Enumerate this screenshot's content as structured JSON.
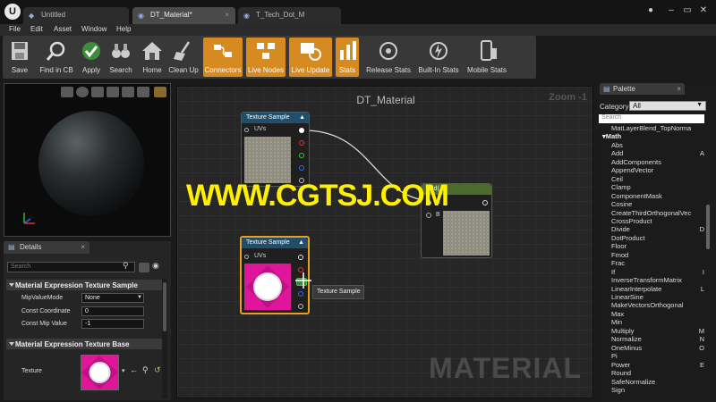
{
  "tabs": [
    {
      "label": "Untitled"
    },
    {
      "label": "DT_Material*"
    },
    {
      "label": "T_Tech_Dot_M"
    }
  ],
  "menu": [
    "File",
    "Edit",
    "Asset",
    "Window",
    "Help"
  ],
  "toolbar": [
    {
      "label": "Save",
      "icon": "save-icon"
    },
    {
      "label": "Find in CB",
      "icon": "find-icon"
    },
    {
      "label": "Apply",
      "icon": "apply-check-icon"
    },
    {
      "label": "Search",
      "icon": "binoculars-icon"
    },
    {
      "label": "Home",
      "icon": "home-icon"
    },
    {
      "label": "Clean Up",
      "icon": "broom-icon"
    },
    {
      "label": "Connectors",
      "icon": "connectors-icon",
      "active": true
    },
    {
      "label": "Live Nodes",
      "icon": "live-nodes-icon",
      "active": true
    },
    {
      "label": "Live Update",
      "icon": "live-update-icon",
      "active": true
    },
    {
      "label": "Stats",
      "icon": "stats-icon",
      "active": true
    },
    {
      "label": "Release Stats",
      "icon": "release-stats-icon"
    },
    {
      "label": "Built-In Stats",
      "icon": "builtin-stats-icon"
    },
    {
      "label": "Mobile Stats",
      "icon": "mobile-stats-icon"
    }
  ],
  "details": {
    "tab_label": "Details",
    "search_placeholder": "Search",
    "section1": "Material Expression Texture Sample",
    "props": [
      {
        "label": "MipValueMode",
        "value": "None"
      },
      {
        "label": "Const Coordinate",
        "value": "0"
      },
      {
        "label": "Const Mip Value",
        "value": "-1"
      }
    ],
    "section2": "Material Expression Texture Base",
    "texture_label": "Texture"
  },
  "graph": {
    "title": "DT_Material",
    "zoom": "Zoom -1",
    "watermark": "MATERIAL",
    "node1": {
      "title": "Texture Sample",
      "uvs": "UVs"
    },
    "node2": {
      "title": "Texture Sample",
      "uvs": "UVs"
    },
    "add_node": {
      "title": "Add(,0)",
      "pin_a": "A",
      "pin_b": "B"
    },
    "tooltip": "Texture Sample"
  },
  "overlay_text": "WWW.CGTSJ.COM",
  "palette": {
    "tab_label": "Palette",
    "category_label": "Category",
    "category_value": "All",
    "search_placeholder": "Search",
    "items": [
      {
        "label": "MatLayerBlend_TopNorma",
        "shortcut": ""
      },
      {
        "label": "Math",
        "category": true
      },
      {
        "label": "Abs",
        "shortcut": ""
      },
      {
        "label": "Add",
        "shortcut": "A"
      },
      {
        "label": "AddComponents",
        "shortcut": ""
      },
      {
        "label": "AppendVector",
        "shortcut": ""
      },
      {
        "label": "Ceil",
        "shortcut": ""
      },
      {
        "label": "Clamp",
        "shortcut": ""
      },
      {
        "label": "ComponentMask",
        "shortcut": ""
      },
      {
        "label": "Cosine",
        "shortcut": ""
      },
      {
        "label": "CreateThirdOrthogonalVec",
        "shortcut": ""
      },
      {
        "label": "CrossProduct",
        "shortcut": ""
      },
      {
        "label": "Divide",
        "shortcut": "D"
      },
      {
        "label": "DotProduct",
        "shortcut": ""
      },
      {
        "label": "Floor",
        "shortcut": ""
      },
      {
        "label": "Fmod",
        "shortcut": ""
      },
      {
        "label": "Frac",
        "shortcut": ""
      },
      {
        "label": "If",
        "shortcut": "I"
      },
      {
        "label": "InverseTransformMatrix",
        "shortcut": ""
      },
      {
        "label": "LinearInterpolate",
        "shortcut": "L"
      },
      {
        "label": "LinearSine",
        "shortcut": ""
      },
      {
        "label": "MakeVectorsOrthogonal",
        "shortcut": ""
      },
      {
        "label": "Max",
        "shortcut": ""
      },
      {
        "label": "Min",
        "shortcut": ""
      },
      {
        "label": "Multiply",
        "shortcut": "M"
      },
      {
        "label": "Normalize",
        "shortcut": "N"
      },
      {
        "label": "OneMinus",
        "shortcut": "O"
      },
      {
        "label": "Pi",
        "shortcut": ""
      },
      {
        "label": "Power",
        "shortcut": "E"
      },
      {
        "label": "Round",
        "shortcut": ""
      },
      {
        "label": "SafeNormalize",
        "shortcut": ""
      },
      {
        "label": "Sign",
        "shortcut": ""
      }
    ]
  },
  "colors": {
    "accent": "#d68a1f",
    "node_header": "#1f4f6a",
    "texture_magenta": "#e0169a",
    "overlay": "#fff000"
  }
}
